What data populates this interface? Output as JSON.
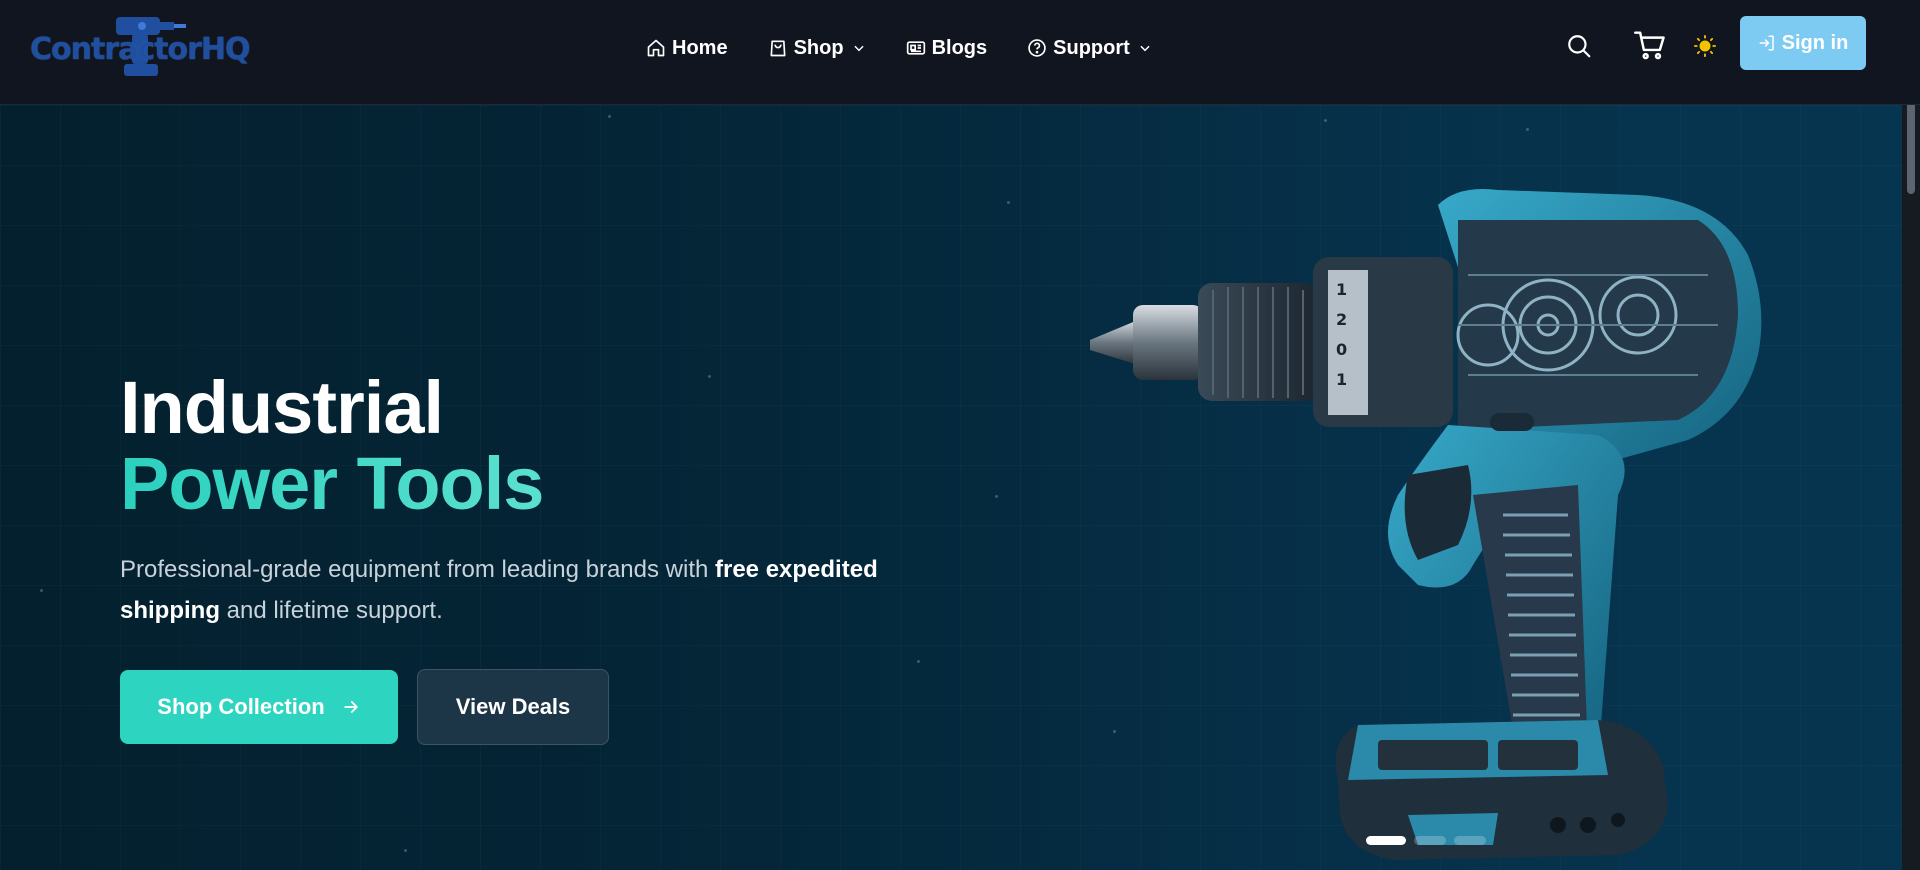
{
  "brand": {
    "logo_text": "ContractorHQ"
  },
  "nav": {
    "items": [
      {
        "label": "Home",
        "icon": "home-icon"
      },
      {
        "label": "Shop",
        "icon": "shopping-bag-icon",
        "dropdown": true
      },
      {
        "label": "Blogs",
        "icon": "newspaper-icon"
      },
      {
        "label": "Support",
        "icon": "help-circle-icon",
        "dropdown": true
      }
    ],
    "signin_label": "Sign in"
  },
  "hero": {
    "title_line1": "Industrial",
    "title_line2": "Power Tools",
    "desc_part1": "Professional-grade equipment from leading brands with ",
    "desc_bold1": "free expedited shipping",
    "desc_part2": " and lifetime support.",
    "primary_button": "Shop Collection",
    "secondary_button": "View Deals",
    "carousel": {
      "slides": 3,
      "active": 1
    }
  },
  "colors": {
    "navbar_bg": "#11151f",
    "accent": "#2dd4bf",
    "signin_bg": "#7dcbf2",
    "theme_icon": "#f5c400",
    "hero_bg": "#042638"
  }
}
